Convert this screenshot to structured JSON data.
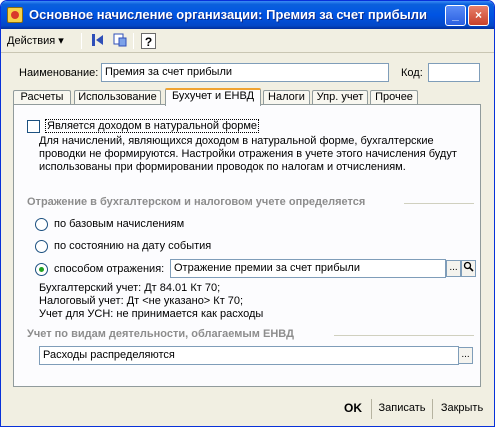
{
  "window": {
    "title": "Основное начисление организации: Премия за счет прибыли",
    "help_button": "_",
    "close_button": "×"
  },
  "toolbar": {
    "actions_label": "Действия ▾",
    "help_label": "?"
  },
  "form": {
    "name_label": "Наименование:",
    "name_value": "Премия за счет прибыли",
    "code_label": "Код:",
    "code_value": ""
  },
  "tabs": [
    {
      "label": "Расчеты",
      "active": false
    },
    {
      "label": "Использование",
      "active": false
    },
    {
      "label": "Бухучет и ЕНВД",
      "active": true
    },
    {
      "label": "Налоги",
      "active": false
    },
    {
      "label": "Упр. учет",
      "active": false
    },
    {
      "label": "Прочее",
      "active": false
    }
  ],
  "panel": {
    "in_kind_checkbox_label": "Является доходом в натуральной форме",
    "in_kind_note": [
      "Для начислений, являющихся доходом в натуральной форме, бухгалтерские",
      "проводки не формируются. Настройки отражения в учете этого начисления будут",
      "использованы при формировании проводок по налогам и отчислениям."
    ],
    "reflection_section_title": "Отражение в бухгалтерском и налоговом учете определяется",
    "radio_options": [
      {
        "label": "по базовым начислениям",
        "selected": false
      },
      {
        "label": "по состоянию на дату события",
        "selected": false
      },
      {
        "label": "способом отражения:",
        "selected": true
      }
    ],
    "reflection_method_value": "Отражение премии за счет прибыли",
    "select_button": "...",
    "open_button": "🔍",
    "accounting_lines": [
      "Бухгалтерский учет: Дт 84.01 Кт 70;",
      "Налоговый учет: Дт <не указано> Кт 70;",
      "Учет для УСН: не принимается как расходы"
    ],
    "envd_section_title": "Учет по видам деятельности, облагаемым ЕНВД",
    "envd_value": "Расходы распределяются",
    "envd_select_button": "..."
  },
  "footer": {
    "ok_label": "OK",
    "save_label": "Записать",
    "close_label": "Закрыть"
  },
  "colors": {
    "title_bar": "#0054e3",
    "window_bg": "#f1efe2",
    "panel_bg": "#fcfcfe",
    "section_title": "#8d8d8d",
    "active_tab_accent": "#f0a330",
    "radio_dot": "#21a121"
  }
}
